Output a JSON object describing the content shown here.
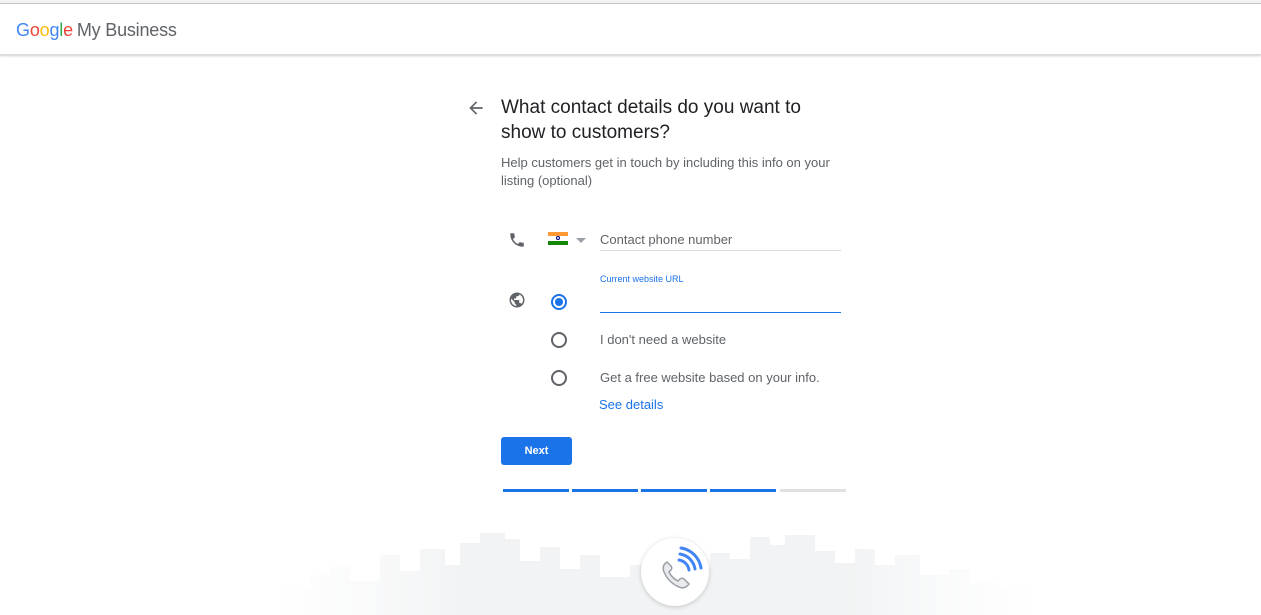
{
  "header": {
    "logo_letters": [
      "G",
      "o",
      "o",
      "g",
      "l",
      "e"
    ],
    "product": "My Business"
  },
  "page": {
    "title": "What contact details do you want to show to customers?",
    "subtitle": "Help customers get in touch by including this info on your listing (optional)"
  },
  "phone": {
    "icon": "phone-icon",
    "country_flag": "india-flag-icon",
    "placeholder": "Contact phone number",
    "value": ""
  },
  "website": {
    "icon": "globe-icon",
    "url_label": "Current website URL",
    "url_value": "",
    "options": [
      {
        "label": "",
        "selected": true
      },
      {
        "label": "I don't need a website",
        "selected": false
      },
      {
        "label": "Get a free website based on your info.",
        "selected": false
      }
    ],
    "see_details": "See details"
  },
  "actions": {
    "next_label": "Next"
  },
  "progress": {
    "completed_steps": 4,
    "total_steps": 5
  },
  "colors": {
    "accent": "#1a73e8",
    "progress_inactive": "#e0e0e0",
    "muted_text": "#5f6368"
  }
}
